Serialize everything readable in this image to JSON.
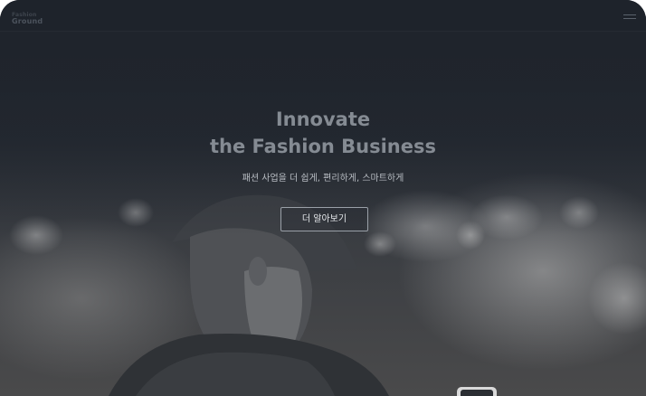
{
  "header": {
    "logo_line1": "Fashion",
    "logo_line2": "Ground",
    "menu_icon": "hamburger-menu-icon"
  },
  "hero": {
    "headline_line1": "Innovate",
    "headline_line2": "the Fashion Business",
    "subcopy": "패션 사업을 더 쉽게, 편리하게, 스마트하게",
    "cta_label": "더 알아보기",
    "background": "grayscale-photo-person-with-mask-and-cap-at-night"
  },
  "colors": {
    "background_dark": "#1f242c",
    "headline": "#858b93",
    "subcopy": "#b9bec4",
    "button_border": "#9aa0a8"
  }
}
